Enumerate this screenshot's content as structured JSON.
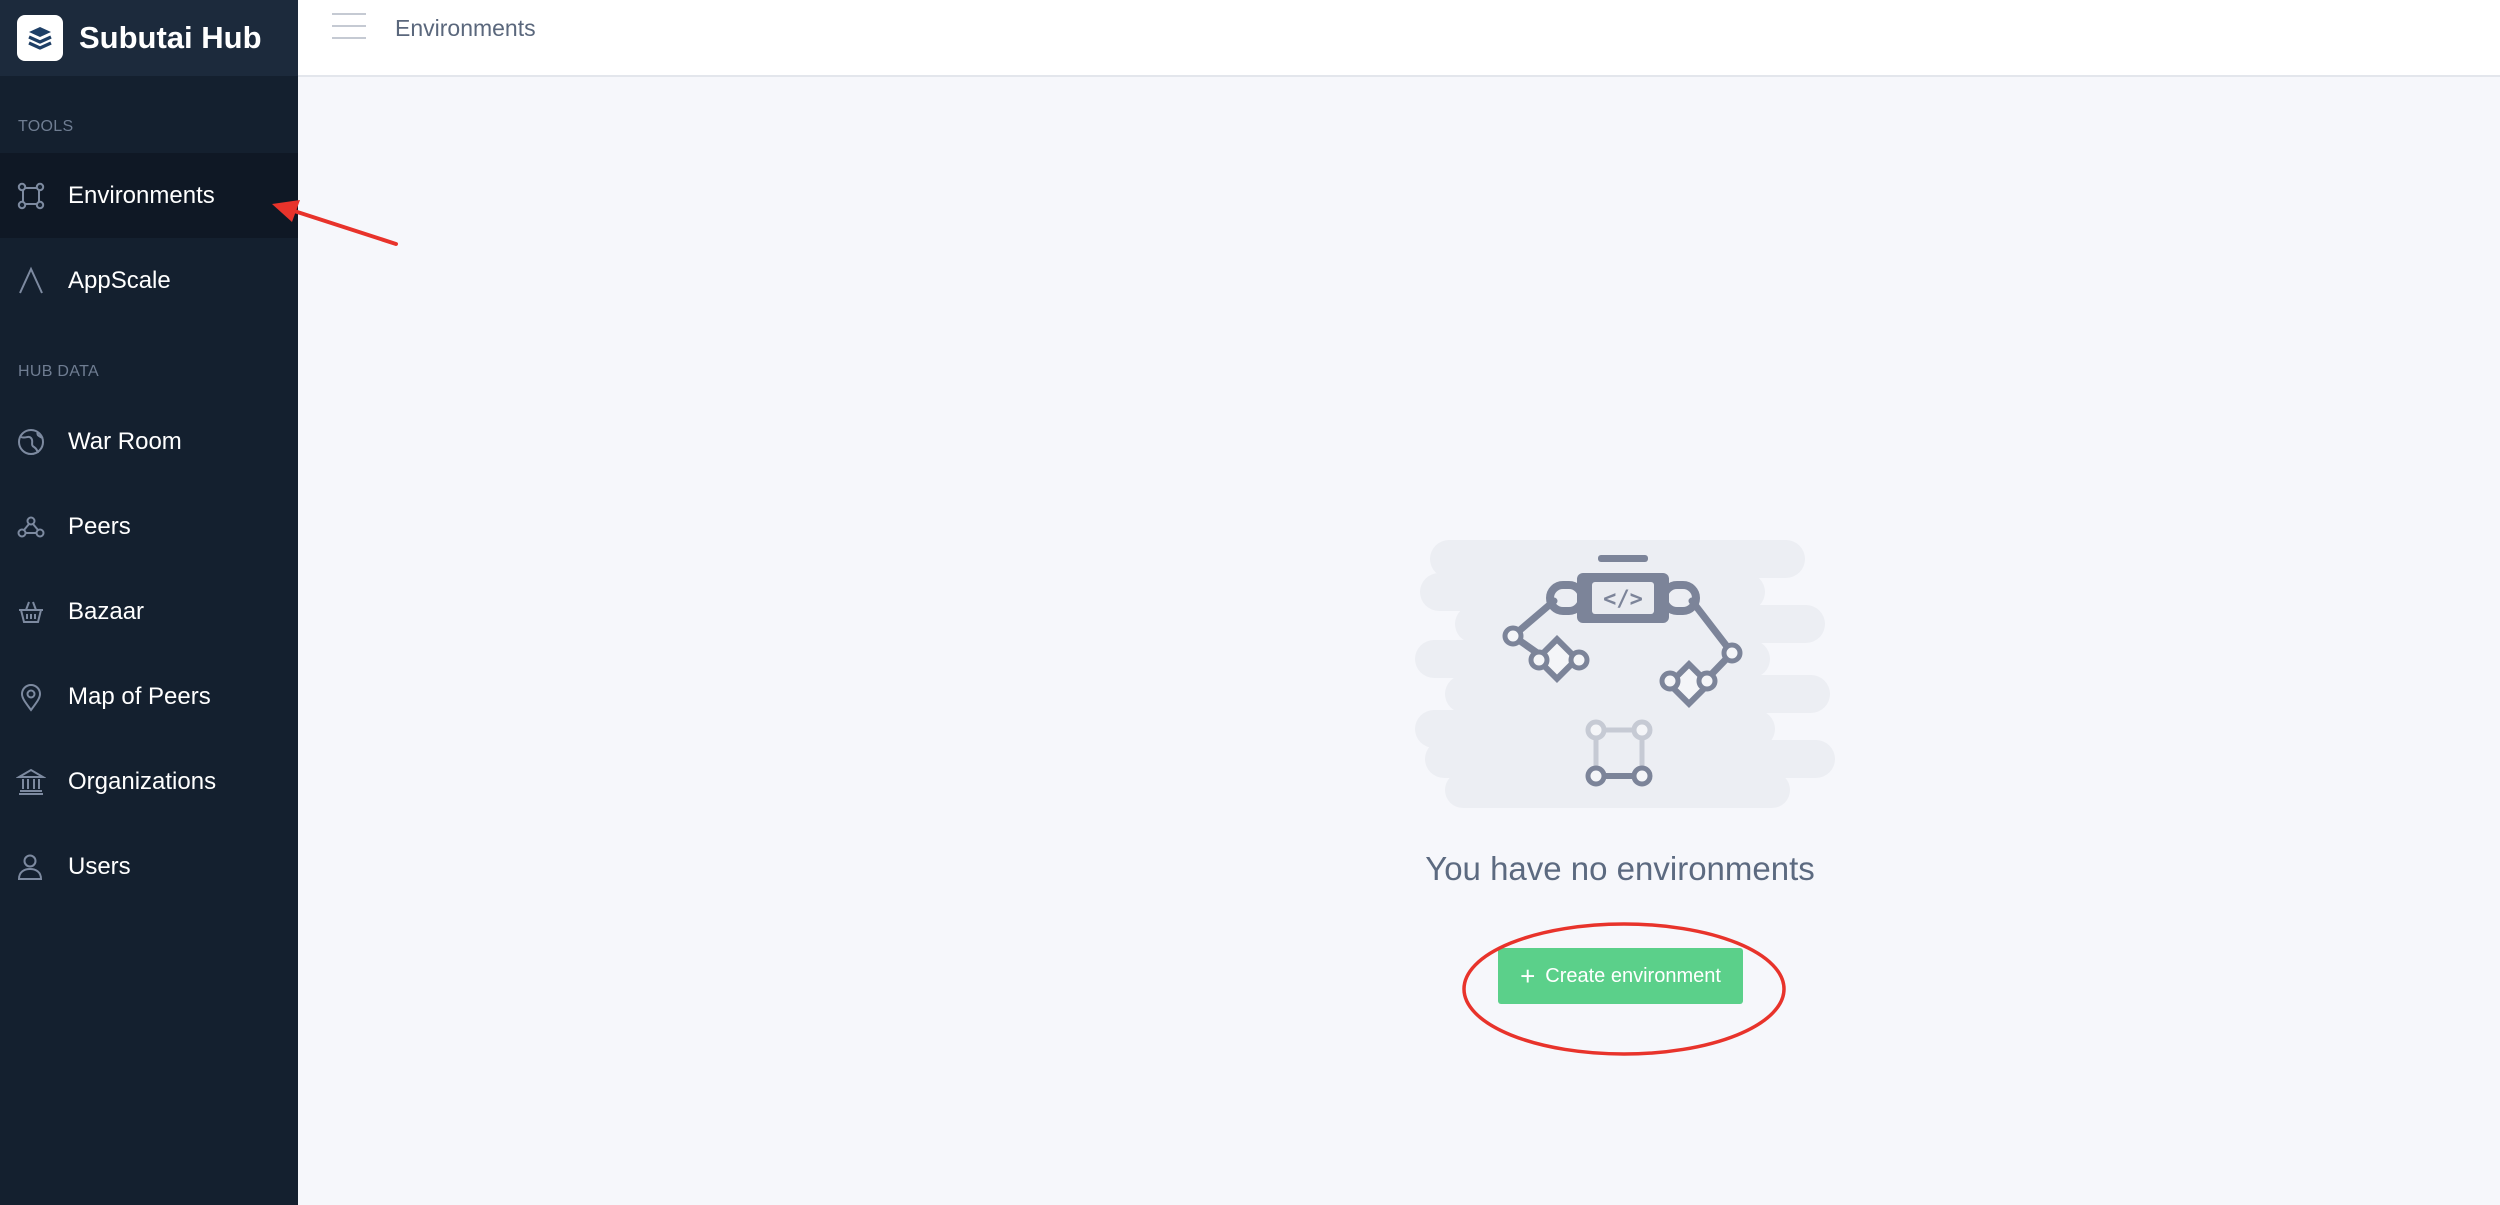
{
  "app": {
    "name": "Subutai Hub"
  },
  "topbar": {
    "title": "Environments"
  },
  "sidebar": {
    "sections": [
      {
        "label": "TOOLS",
        "items": [
          {
            "label": "Environments",
            "icon": "environments-icon",
            "active": true
          },
          {
            "label": "AppScale",
            "icon": "appscale-icon",
            "active": false
          }
        ]
      },
      {
        "label": "HUB DATA",
        "items": [
          {
            "label": "War Room",
            "icon": "globe-icon",
            "active": false
          },
          {
            "label": "Peers",
            "icon": "peers-icon",
            "active": false
          },
          {
            "label": "Bazaar",
            "icon": "basket-icon",
            "active": false
          },
          {
            "label": "Map of Peers",
            "icon": "map-pin-icon",
            "active": false
          },
          {
            "label": "Organizations",
            "icon": "institution-icon",
            "active": false
          },
          {
            "label": "Users",
            "icon": "user-icon",
            "active": false
          }
        ]
      }
    ]
  },
  "main": {
    "empty_message": "You have no environments",
    "create_button": {
      "icon": "+",
      "label": "Create environment"
    }
  },
  "colors": {
    "sidebar_bg": "#14202f",
    "brand_bg": "#1c2a3c",
    "active_item_bg": "#0f1825",
    "accent_green": "#5bd08a",
    "annotation_red": "#e8332b"
  }
}
